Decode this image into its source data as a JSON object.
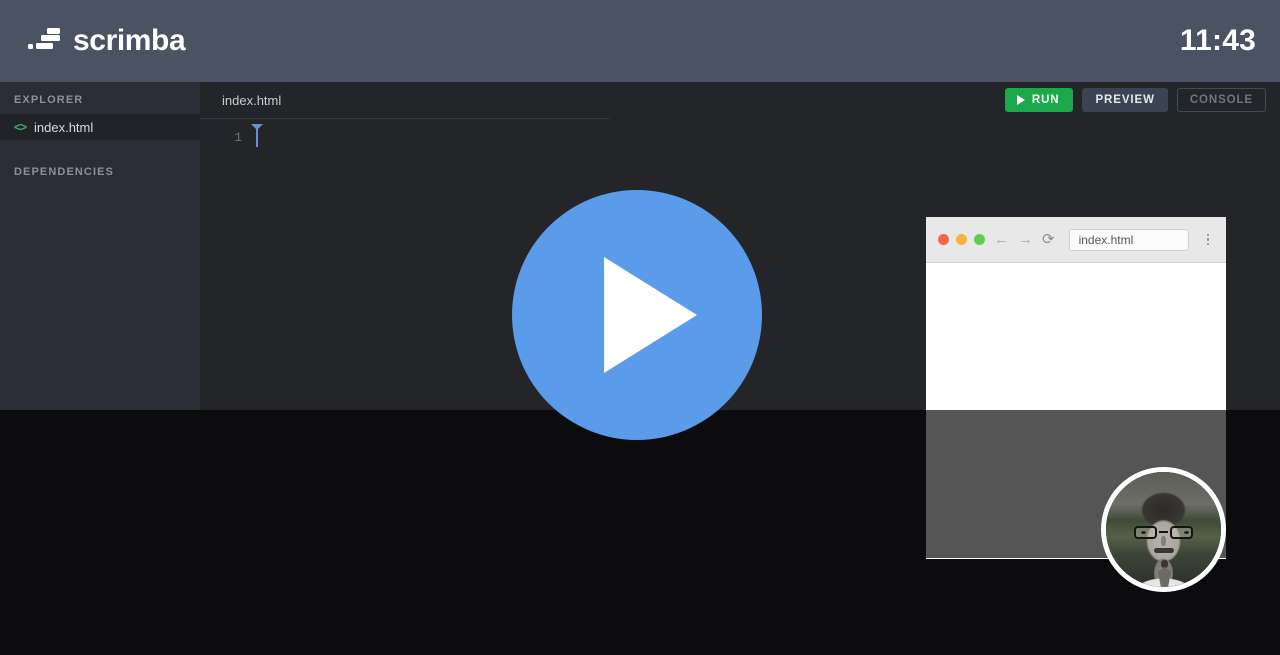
{
  "header": {
    "brand_name": "scrimba",
    "brand_mark_icon": "scrimba-logo-icon",
    "clock": "11:43"
  },
  "sidebar": {
    "explorer_title": "EXPLORER",
    "dependencies_title": "DEPENDENCIES",
    "files": [
      {
        "name": "index.html",
        "icon": "code-file-icon",
        "icon_color": "#3fae63",
        "selected": true
      }
    ]
  },
  "editor": {
    "tab_name": "index.html",
    "line_numbers": [
      "1"
    ],
    "code_lines": [
      ""
    ],
    "caret_icon": "text-caret-icon",
    "actions": {
      "run_label": "RUN",
      "run_icon": "play-icon",
      "run_color": "#1aa84a",
      "preview_label": "PREVIEW",
      "preview_color": "#3c4453",
      "console_label": "CONSOLE",
      "console_color": "#6f7682"
    }
  },
  "player": {
    "play_button_icon": "play-icon",
    "play_button_color": "#5a9bea"
  },
  "preview_window": {
    "traffic_lights": [
      {
        "name": "close-dot",
        "color": "#f1664b"
      },
      {
        "name": "minimize-dot",
        "color": "#f6b33e"
      },
      {
        "name": "maximize-dot",
        "color": "#5fcd4f"
      }
    ],
    "back_icon": "arrow-left-icon",
    "back_glyph": "←",
    "forward_icon": "arrow-right-icon",
    "forward_glyph": "→",
    "reload_icon": "reload-icon",
    "reload_glyph": "⟳",
    "url_value": "index.html",
    "url_placeholder": "index.html",
    "menu_icon": "kebab-menu-icon",
    "content_bg": "#ffffff",
    "lower_bg": "#555555"
  },
  "webcam": {
    "avatar_icon": "presenter-avatar",
    "border_color": "#ffffff"
  },
  "theme": {
    "header_bg": "#4a5263",
    "sidebar_bg": "#2a2d36",
    "editor_bg": "#242528",
    "stage_bg": "#0c0c0e"
  }
}
